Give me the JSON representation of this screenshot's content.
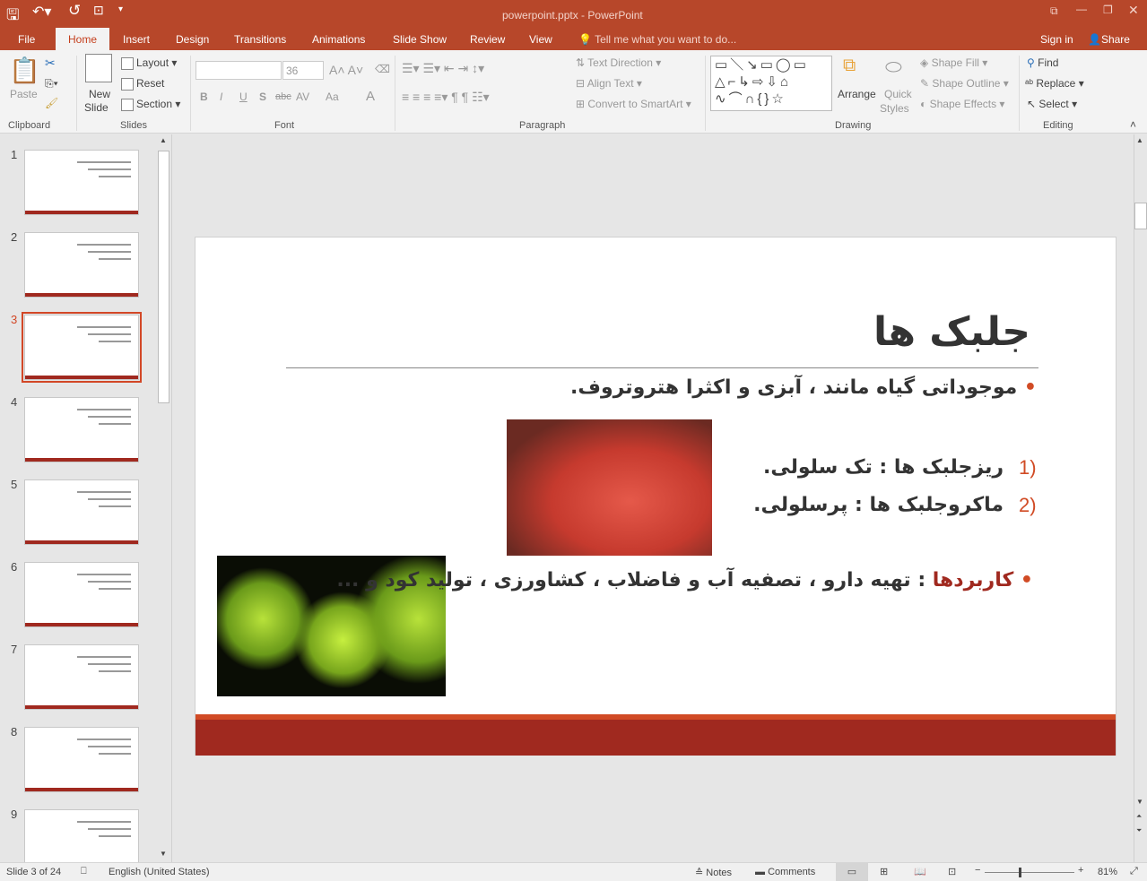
{
  "window": {
    "title": "powerpoint.pptx - PowerPoint"
  },
  "tabs": [
    {
      "label": "File"
    },
    {
      "label": "Home"
    },
    {
      "label": "Insert"
    },
    {
      "label": "Design"
    },
    {
      "label": "Transitions"
    },
    {
      "label": "Animations"
    },
    {
      "label": "Slide Show"
    },
    {
      "label": "Review"
    },
    {
      "label": "View"
    }
  ],
  "tell_me": "Tell me what you want to do...",
  "sign_in": "Sign in",
  "share": "Share",
  "ribbon": {
    "clipboard": {
      "paste": "Paste",
      "label": "Clipboard"
    },
    "slides": {
      "new_slide_1": "New",
      "new_slide_2": "Slide",
      "layout": "Layout",
      "reset": "Reset",
      "section": "Section",
      "label": "Slides"
    },
    "font": {
      "font_name": "",
      "font_size": "36",
      "label": "Font",
      "bold": "B",
      "italic": "I",
      "underline": "U",
      "shadow": "S",
      "strike": "abc",
      "spacing": "AV",
      "case": "Aa",
      "color": "A"
    },
    "paragraph": {
      "text_direction": "Text Direction",
      "align_text": "Align Text",
      "smartart": "Convert to SmartArt",
      "label": "Paragraph"
    },
    "drawing": {
      "arrange": "Arrange",
      "quick_styles_1": "Quick",
      "quick_styles_2": "Styles",
      "shape_fill": "Shape Fill",
      "shape_outline": "Shape Outline",
      "shape_effects": "Shape Effects",
      "label": "Drawing"
    },
    "editing": {
      "find": "Find",
      "replace": "Replace",
      "select": "Select",
      "label": "Editing"
    }
  },
  "thumbnails": [
    {
      "num": "1"
    },
    {
      "num": "2"
    },
    {
      "num": "3",
      "selected": true
    },
    {
      "num": "4"
    },
    {
      "num": "5"
    },
    {
      "num": "6"
    },
    {
      "num": "7"
    },
    {
      "num": "8"
    },
    {
      "num": "9"
    }
  ],
  "slide": {
    "title": "جلبک ها",
    "bullet1": "موجوداتی گیاه مانند ، آبزی و اکثرا هتروتروف.",
    "item1_num": "1)",
    "item1": "ریزجلبک ها : تک سلولی.",
    "item2_num": "2)",
    "item2": "ماکروجلبک ها : پرسلولی.",
    "bullet2_key": "کاربردها",
    "bullet2_rest": " : تهیه دارو ، تصفیه آب و فاضلاب ، کشاورزی ، تولید کود و ...",
    "accent": "#a0291f",
    "accent_line": "#d14b25"
  },
  "status": {
    "slide_of": "Slide 3 of 24",
    "language": "English (United States)",
    "notes": "Notes",
    "comments": "Comments",
    "zoom": "81%"
  }
}
